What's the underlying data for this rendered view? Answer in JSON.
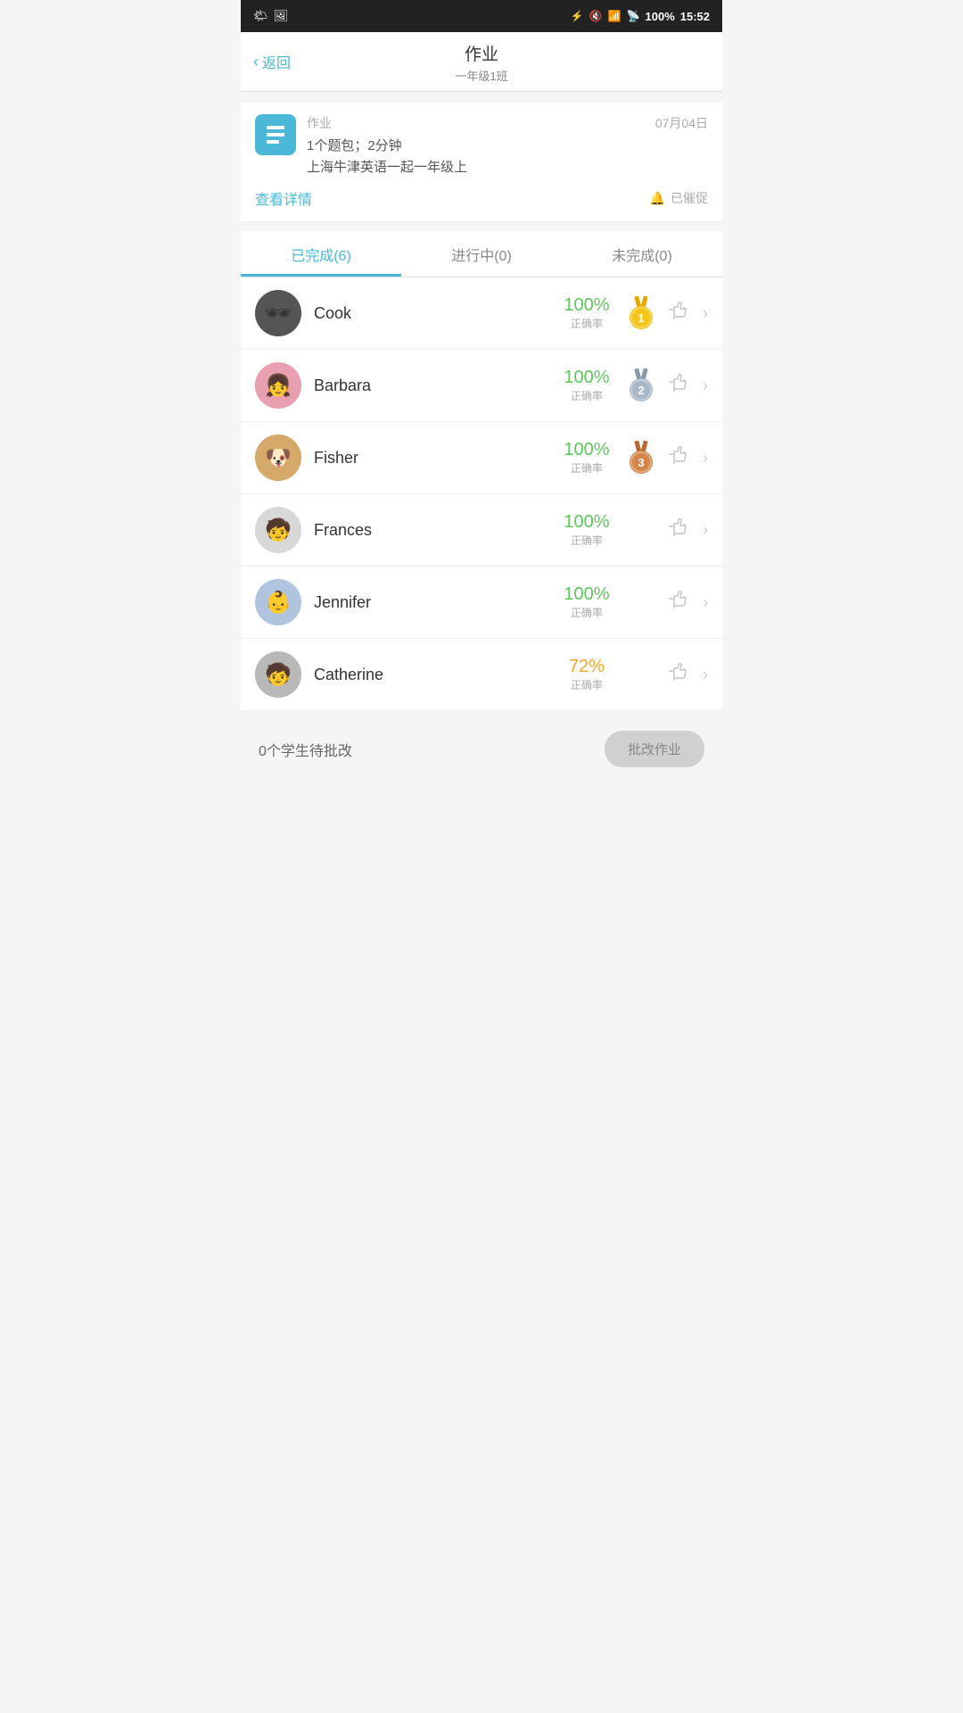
{
  "statusBar": {
    "time": "15:52",
    "battery": "100%"
  },
  "nav": {
    "back_label": "返回",
    "title": "作业",
    "subtitle": "一年级1班"
  },
  "assignment": {
    "type_label": "作业",
    "date": "07月04日",
    "desc_line1": "1个题包；2分钟",
    "desc_line2": "上海牛津英语一起一年级上",
    "view_detail": "查看详情",
    "reminded": "已催促"
  },
  "tabs": [
    {
      "id": "done",
      "label": "已完成(6)",
      "active": true
    },
    {
      "id": "inprogress",
      "label": "进行中(0)",
      "active": false
    },
    {
      "id": "notdone",
      "label": "未完成(0)",
      "active": false
    }
  ],
  "students": [
    {
      "name": "Cook",
      "score": "100%",
      "score_label": "正确率",
      "medal_rank": 1,
      "avatar_type": "cook",
      "avatar_emoji": "🕶"
    },
    {
      "name": "Barbara",
      "score": "100%",
      "score_label": "正确率",
      "medal_rank": 2,
      "avatar_type": "barbara",
      "avatar_emoji": "👧"
    },
    {
      "name": "Fisher",
      "score": "100%",
      "score_label": "正确率",
      "medal_rank": 3,
      "avatar_type": "fisher",
      "avatar_emoji": "🐶"
    },
    {
      "name": "Frances",
      "score": "100%",
      "score_label": "正确率",
      "medal_rank": 0,
      "avatar_type": "frances",
      "avatar_emoji": "🧒"
    },
    {
      "name": "Jennifer",
      "score": "100%",
      "score_label": "正确率",
      "medal_rank": 0,
      "avatar_type": "jennifer",
      "avatar_emoji": "👶"
    },
    {
      "name": "Catherine",
      "score": "72%",
      "score_label": "正确率",
      "medal_rank": 0,
      "avatar_type": "catherine",
      "avatar_emoji": "🧒"
    }
  ],
  "bottom": {
    "pending_label": "0个学生待批改",
    "grade_btn": "批改作业"
  }
}
